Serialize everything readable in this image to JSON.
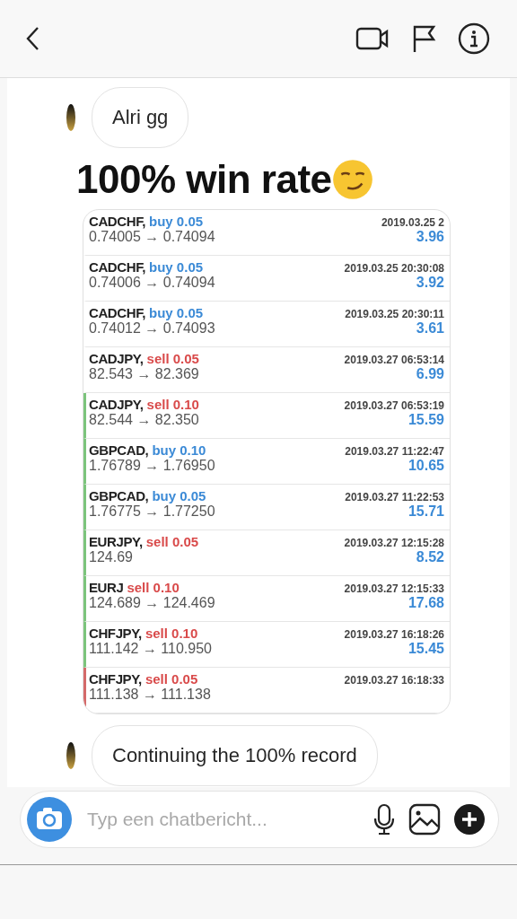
{
  "header": {
    "icons": [
      {
        "kind": "video"
      },
      {
        "kind": "flag"
      },
      {
        "kind": "info"
      }
    ]
  },
  "messages": [
    {
      "kind": "bubble",
      "text": "Alri gg"
    },
    {
      "kind": "headline",
      "text": "100% win rate"
    },
    {
      "kind": "image",
      "trades": [
        {
          "pair": "CADCHF,",
          "kind": "buy",
          "lot": "buy 0.05",
          "time": "2019.03.25 2",
          "prices": "0.74005 → 0.74094",
          "profit": "3.96"
        },
        {
          "pair": "CADCHF,",
          "kind": "buy",
          "lot": "buy 0.05",
          "time": "2019.03.25 20:30:08",
          "prices": "0.74006 → 0.74094",
          "profit": "3.92"
        },
        {
          "pair": "CADCHF,",
          "kind": "buy",
          "lot": "buy 0.05",
          "time": "2019.03.25 20:30:11",
          "prices": "0.74012 → 0.74093",
          "profit": "3.61"
        },
        {
          "pair": "CADJPY,",
          "kind": "sell",
          "lot": "sell 0.05",
          "time": "2019.03.27 06:53:14",
          "prices": "82.543 → 82.369",
          "profit": "6.99"
        },
        {
          "pair": "CADJPY,",
          "kind": "sell",
          "lot": "sell 0.10",
          "time": "2019.03.27 06:53:19",
          "prices": "82.544 → 82.350",
          "profit": "15.59",
          "color": "#7cc47c"
        },
        {
          "pair": "GBPCAD,",
          "kind": "buy",
          "lot": "buy 0.10",
          "time": "2019.03.27 11:22:47",
          "prices": "1.76789 → 1.76950",
          "profit": "10.65",
          "color": "#7cc47c"
        },
        {
          "pair": "GBPCAD,",
          "kind": "buy",
          "lot": "buy 0.05",
          "time": "2019.03.27 11:22:53",
          "prices": "1.76775 → 1.77250",
          "profit": "15.71",
          "color": "#7cc47c"
        },
        {
          "pair": "EURJPY,",
          "kind": "sell",
          "lot": "sell 0.05",
          "time": "2019.03.27 12:15:28",
          "prices": "124.69",
          "profit": "8.52",
          "color": "#7cc47c"
        },
        {
          "pair": "EURJ",
          "kind": "sell",
          "lot": "sell 0.10",
          "time": "2019.03.27 12:15:33",
          "prices": "124.689 → 124.469",
          "profit": "17.68",
          "color": "#7cc47c"
        },
        {
          "pair": "CHFJPY,",
          "kind": "sell",
          "lot": "sell 0.10",
          "time": "2019.03.27 16:18:26",
          "prices": "111.142 → 110.950",
          "profit": "15.45",
          "color": "#7cc47c"
        },
        {
          "pair": "CHFJPY,",
          "kind": "sell",
          "lot": "sell 0.05",
          "time": "2019.03.27 16:18:33",
          "prices": "111.138 → 111.138",
          "color": "#d46a6a"
        }
      ]
    },
    {
      "kind": "bubble",
      "text": "Continuing the 100% record"
    }
  ],
  "composer": {
    "placeholder": "Typ een chatbericht..."
  }
}
